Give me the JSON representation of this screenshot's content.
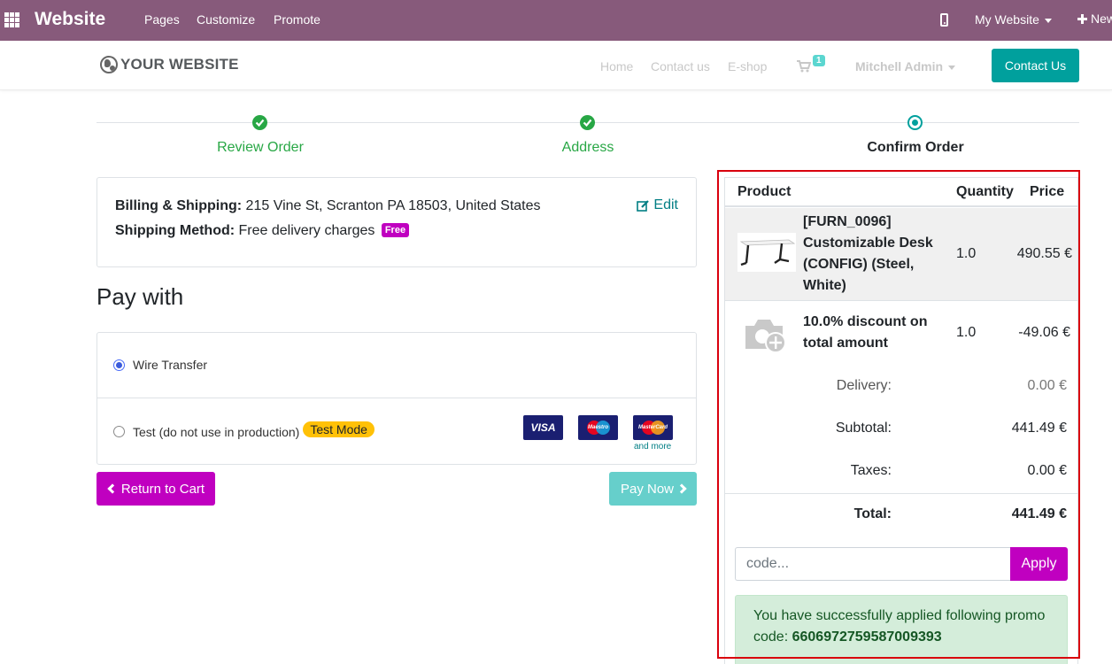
{
  "admin_bar": {
    "brand": "Website",
    "menu": [
      "Pages",
      "Customize",
      "Promote"
    ],
    "my_website": "My Website",
    "new_label": "New"
  },
  "header": {
    "logo_text": "YOUR WEBSITE",
    "nav": [
      "Home",
      "Contact us",
      "E-shop"
    ],
    "cart_count": "1",
    "user": "Mitchell Admin",
    "contact_button": "Contact Us"
  },
  "wizard": {
    "steps": [
      {
        "label": "Review Order",
        "state": "done"
      },
      {
        "label": "Address",
        "state": "done"
      },
      {
        "label": "Confirm Order",
        "state": "current"
      }
    ]
  },
  "address": {
    "billing_label": "Billing & Shipping:",
    "billing_value": "215 Vine St, Scranton PA 18503, United States",
    "shipping_label": "Shipping Method:",
    "shipping_value": "Free delivery charges",
    "free_badge": "Free",
    "edit_label": "Edit"
  },
  "payment": {
    "title": "Pay with",
    "methods": [
      {
        "label": "Wire Transfer",
        "selected": true
      },
      {
        "label": "Test (do not use in production)",
        "badge": "Test Mode",
        "selected": false
      }
    ],
    "card_logos": {
      "visa": "VISA",
      "maestro": "Maestro",
      "mastercard": "MasterCard"
    },
    "and_more": "and more",
    "return_button": "Return to Cart",
    "pay_button": "Pay Now"
  },
  "summary": {
    "columns": [
      "Product",
      "Quantity",
      "Price"
    ],
    "lines": [
      {
        "name": "[FURN_0096] Customizable Desk (CONFIG) (Steel, White)",
        "qty": "1.0",
        "price": "490.55 €"
      },
      {
        "name": "10.0% discount on total amount",
        "qty": "1.0",
        "price": "-49.06 €"
      }
    ],
    "delivery_label": "Delivery:",
    "delivery_value": "0.00 €",
    "subtotal_label": "Subtotal:",
    "subtotal_value": "441.49 €",
    "taxes_label": "Taxes:",
    "taxes_value": "0.00 €",
    "total_label": "Total:",
    "total_value": "441.49 €",
    "promo_placeholder": "code...",
    "apply_button": "Apply",
    "promo_message": "You have successfully applied following promo code:",
    "promo_code": "6606972759587009393"
  },
  "colors": {
    "admin_bar": "#875a7b",
    "primary": "#00a09d",
    "secondary": "#c000c0",
    "success": "#28a745",
    "highlight": "#d9000d"
  }
}
